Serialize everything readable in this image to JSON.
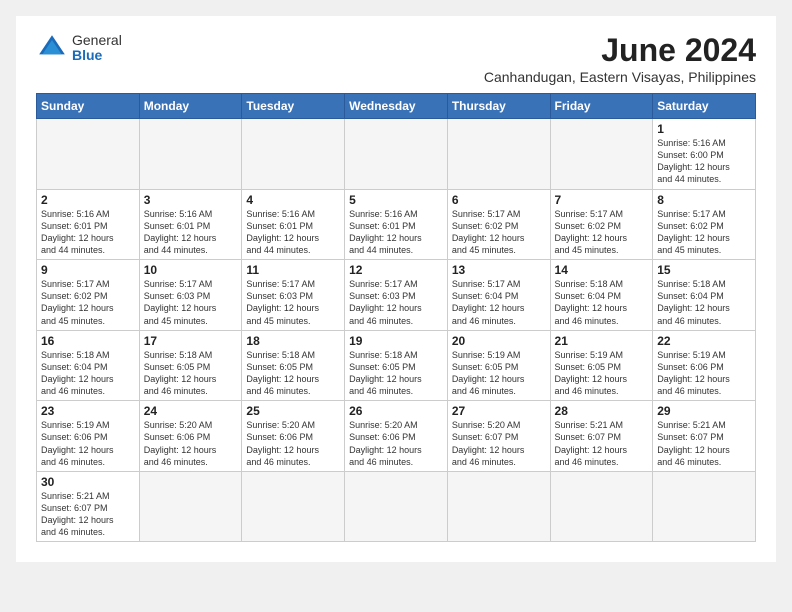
{
  "header": {
    "logo_general": "General",
    "logo_blue": "Blue",
    "title": "June 2024",
    "subtitle": "Canhandugan, Eastern Visayas, Philippines"
  },
  "days_of_week": [
    "Sunday",
    "Monday",
    "Tuesday",
    "Wednesday",
    "Thursday",
    "Friday",
    "Saturday"
  ],
  "weeks": [
    [
      {
        "day": "",
        "empty": true
      },
      {
        "day": "",
        "empty": true
      },
      {
        "day": "",
        "empty": true
      },
      {
        "day": "",
        "empty": true
      },
      {
        "day": "",
        "empty": true
      },
      {
        "day": "",
        "empty": true
      },
      {
        "day": "1",
        "sunrise": "5:16 AM",
        "sunset": "6:00 PM",
        "daylight_h": "12",
        "daylight_m": "44"
      }
    ],
    [
      {
        "day": "2",
        "sunrise": "5:16 AM",
        "sunset": "6:01 PM",
        "daylight_h": "12",
        "daylight_m": "44"
      },
      {
        "day": "3",
        "sunrise": "5:16 AM",
        "sunset": "6:01 PM",
        "daylight_h": "12",
        "daylight_m": "44"
      },
      {
        "day": "4",
        "sunrise": "5:16 AM",
        "sunset": "6:01 PM",
        "daylight_h": "12",
        "daylight_m": "44"
      },
      {
        "day": "5",
        "sunrise": "5:16 AM",
        "sunset": "6:01 PM",
        "daylight_h": "12",
        "daylight_m": "44"
      },
      {
        "day": "6",
        "sunrise": "5:17 AM",
        "sunset": "6:02 PM",
        "daylight_h": "12",
        "daylight_m": "45"
      },
      {
        "day": "7",
        "sunrise": "5:17 AM",
        "sunset": "6:02 PM",
        "daylight_h": "12",
        "daylight_m": "45"
      },
      {
        "day": "8",
        "sunrise": "5:17 AM",
        "sunset": "6:02 PM",
        "daylight_h": "12",
        "daylight_m": "45"
      }
    ],
    [
      {
        "day": "9",
        "sunrise": "5:17 AM",
        "sunset": "6:02 PM",
        "daylight_h": "12",
        "daylight_m": "45"
      },
      {
        "day": "10",
        "sunrise": "5:17 AM",
        "sunset": "6:03 PM",
        "daylight_h": "12",
        "daylight_m": "45"
      },
      {
        "day": "11",
        "sunrise": "5:17 AM",
        "sunset": "6:03 PM",
        "daylight_h": "12",
        "daylight_m": "45"
      },
      {
        "day": "12",
        "sunrise": "5:17 AM",
        "sunset": "6:03 PM",
        "daylight_h": "12",
        "daylight_m": "46"
      },
      {
        "day": "13",
        "sunrise": "5:17 AM",
        "sunset": "6:04 PM",
        "daylight_h": "12",
        "daylight_m": "46"
      },
      {
        "day": "14",
        "sunrise": "5:18 AM",
        "sunset": "6:04 PM",
        "daylight_h": "12",
        "daylight_m": "46"
      },
      {
        "day": "15",
        "sunrise": "5:18 AM",
        "sunset": "6:04 PM",
        "daylight_h": "12",
        "daylight_m": "46"
      }
    ],
    [
      {
        "day": "16",
        "sunrise": "5:18 AM",
        "sunset": "6:04 PM",
        "daylight_h": "12",
        "daylight_m": "46"
      },
      {
        "day": "17",
        "sunrise": "5:18 AM",
        "sunset": "6:05 PM",
        "daylight_h": "12",
        "daylight_m": "46"
      },
      {
        "day": "18",
        "sunrise": "5:18 AM",
        "sunset": "6:05 PM",
        "daylight_h": "12",
        "daylight_m": "46"
      },
      {
        "day": "19",
        "sunrise": "5:18 AM",
        "sunset": "6:05 PM",
        "daylight_h": "12",
        "daylight_m": "46"
      },
      {
        "day": "20",
        "sunrise": "5:19 AM",
        "sunset": "6:05 PM",
        "daylight_h": "12",
        "daylight_m": "46"
      },
      {
        "day": "21",
        "sunrise": "5:19 AM",
        "sunset": "6:05 PM",
        "daylight_h": "12",
        "daylight_m": "46"
      },
      {
        "day": "22",
        "sunrise": "5:19 AM",
        "sunset": "6:06 PM",
        "daylight_h": "12",
        "daylight_m": "46"
      }
    ],
    [
      {
        "day": "23",
        "sunrise": "5:19 AM",
        "sunset": "6:06 PM",
        "daylight_h": "12",
        "daylight_m": "46"
      },
      {
        "day": "24",
        "sunrise": "5:20 AM",
        "sunset": "6:06 PM",
        "daylight_h": "12",
        "daylight_m": "46"
      },
      {
        "day": "25",
        "sunrise": "5:20 AM",
        "sunset": "6:06 PM",
        "daylight_h": "12",
        "daylight_m": "46"
      },
      {
        "day": "26",
        "sunrise": "5:20 AM",
        "sunset": "6:06 PM",
        "daylight_h": "12",
        "daylight_m": "46"
      },
      {
        "day": "27",
        "sunrise": "5:20 AM",
        "sunset": "6:07 PM",
        "daylight_h": "12",
        "daylight_m": "46"
      },
      {
        "day": "28",
        "sunrise": "5:21 AM",
        "sunset": "6:07 PM",
        "daylight_h": "12",
        "daylight_m": "46"
      },
      {
        "day": "29",
        "sunrise": "5:21 AM",
        "sunset": "6:07 PM",
        "daylight_h": "12",
        "daylight_m": "46"
      }
    ],
    [
      {
        "day": "30",
        "sunrise": "5:21 AM",
        "sunset": "6:07 PM",
        "daylight_h": "12",
        "daylight_m": "46"
      },
      {
        "day": "",
        "empty": true
      },
      {
        "day": "",
        "empty": true
      },
      {
        "day": "",
        "empty": true
      },
      {
        "day": "",
        "empty": true
      },
      {
        "day": "",
        "empty": true
      },
      {
        "day": "",
        "empty": true
      }
    ]
  ]
}
